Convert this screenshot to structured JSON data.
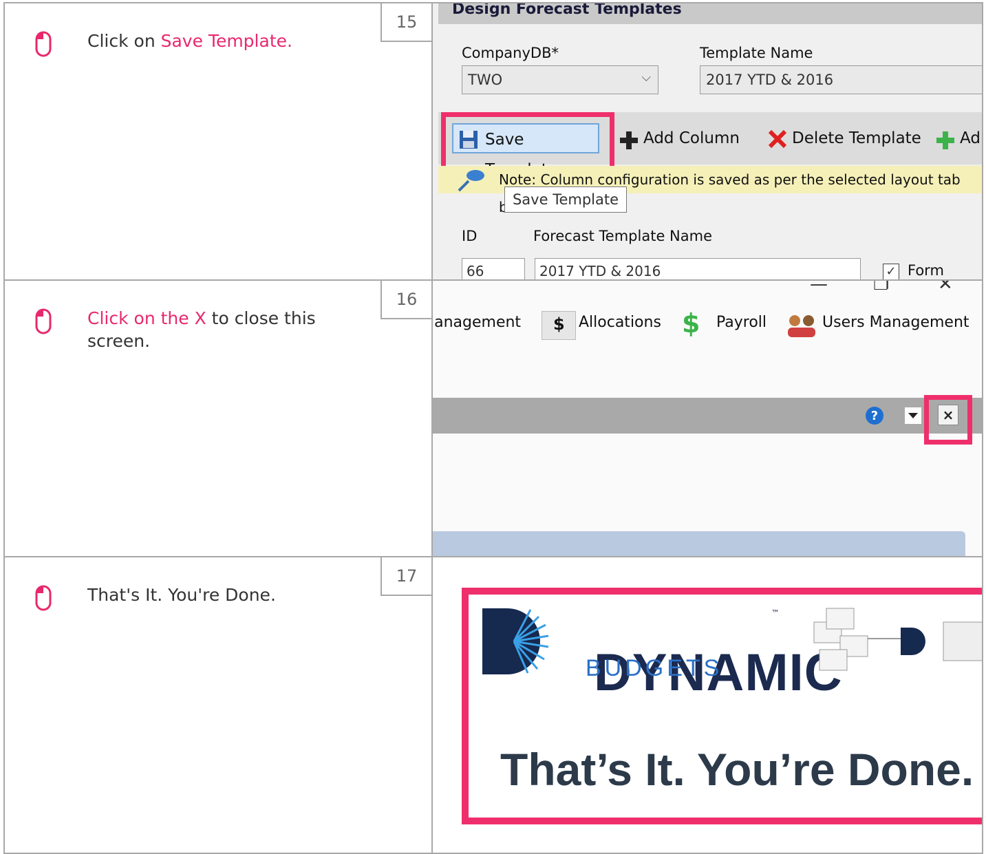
{
  "steps": [
    {
      "number": "15",
      "text_before": "Click on ",
      "highlight": "Save Template.",
      "text_after": ""
    },
    {
      "number": "16",
      "text_before": "",
      "highlight": "Click on the X",
      "text_after": " to close this screen."
    },
    {
      "number": "17",
      "text_before": "That's It. You're Done.",
      "highlight": "",
      "text_after": ""
    }
  ],
  "shot1": {
    "window_title": "Design Forecast Templates",
    "companydb_label": "CompanyDB*",
    "companydb_value": "TWO",
    "template_name_label": "Template Name",
    "template_name_value": "2017 YTD & 2016",
    "toolbar": {
      "save": "Save Template",
      "add_column": "Add Column",
      "delete_template": "Delete Template",
      "add_partial": "Ad"
    },
    "note": "Note: Column configuration is saved as per the selected layout tab below",
    "tooltip": "Save Template",
    "id_label": "ID",
    "forecast_template_name_label": "Forecast Template Name",
    "id_value": "66",
    "forecast_template_name_value": "2017 YTD & 2016",
    "form_enable_partial": "Form Enabl"
  },
  "shot2": {
    "menu": [
      "lanagement",
      "Allocations",
      "Payroll",
      "Users Management"
    ]
  },
  "shot3": {
    "brand": "DYNAMIC",
    "trademark": "™",
    "sub": "BUDGETS",
    "done": "That’s It. You’re Done."
  },
  "colors": {
    "accent": "#ef2f6b",
    "border": "#a8a8a8"
  }
}
